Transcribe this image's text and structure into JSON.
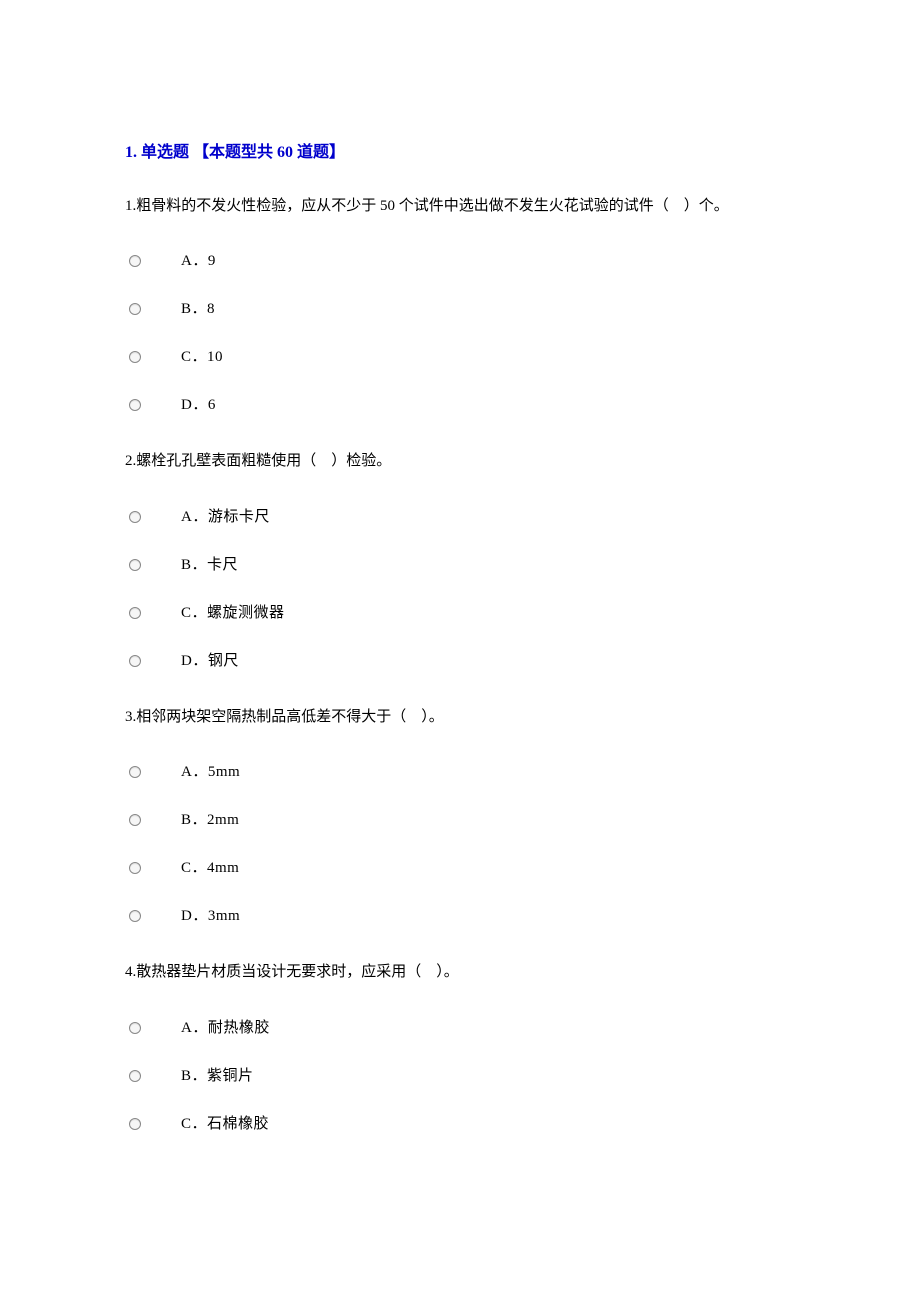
{
  "section_header": "1. 单选题 【本题型共 60 道题】",
  "questions": [
    {
      "text": "1.粗骨料的不发火性检验，应从不少于 50 个试件中选出做不发生火花试验的试件（ ）个。",
      "options": [
        "A．9",
        "B．8",
        "C．10",
        "D．6"
      ]
    },
    {
      "text": "2.螺栓孔孔壁表面粗糙使用（ ）检验。",
      "options": [
        "A．游标卡尺",
        "B．卡尺",
        "C．螺旋测微器",
        "D．钢尺"
      ]
    },
    {
      "text": "3.相邻两块架空隔热制品高低差不得大于（ ）。",
      "options": [
        "A．5mm",
        "B．2mm",
        "C．4mm",
        "D．3mm"
      ]
    },
    {
      "text": "4.散热器垫片材质当设计无要求时，应采用（ ）。",
      "options": [
        "A．耐热橡胶",
        "B．紫铜片",
        "C．石棉橡胶"
      ]
    }
  ]
}
